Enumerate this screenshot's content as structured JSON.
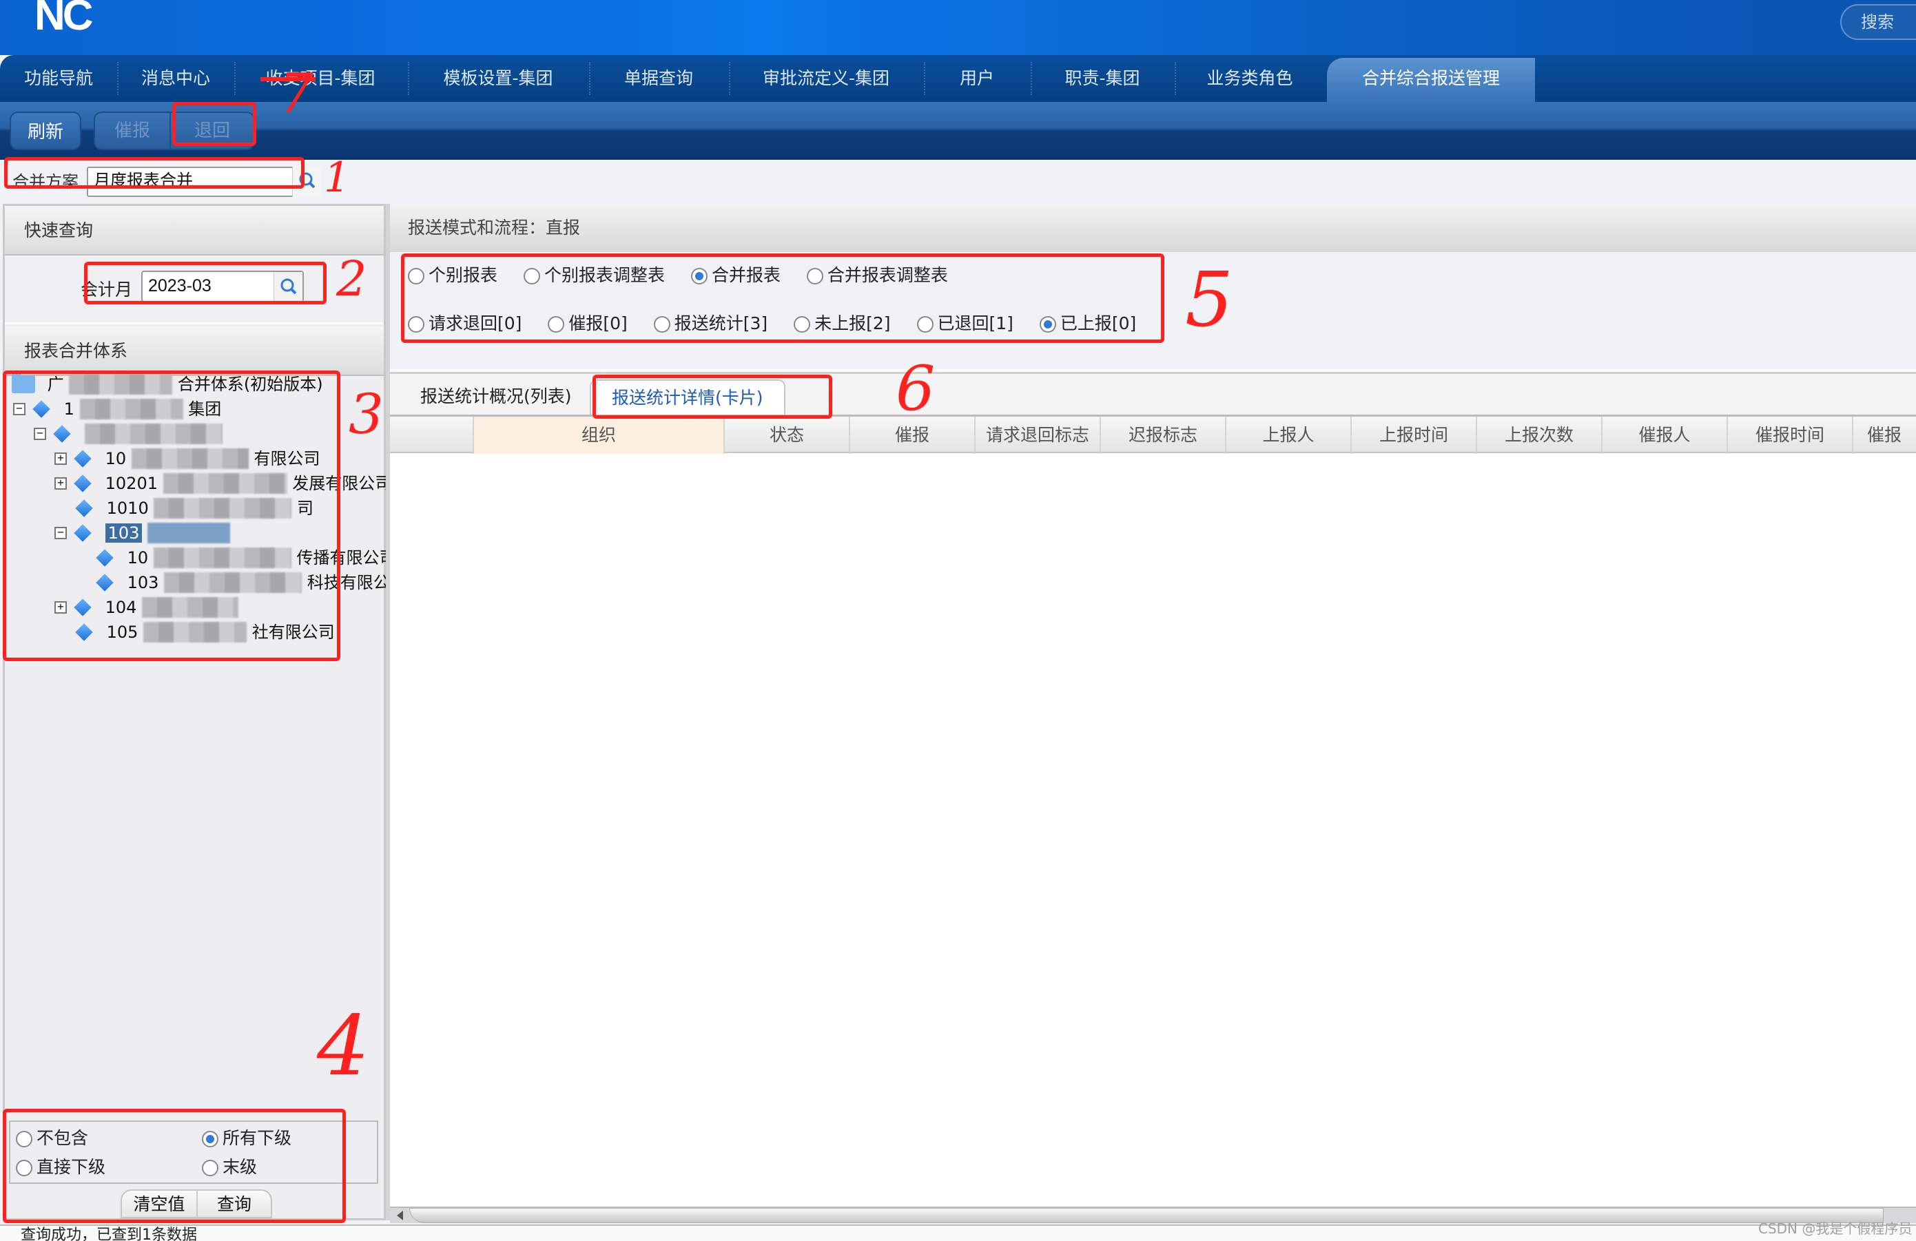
{
  "app": {
    "logo": "NC",
    "search_label": "搜索"
  },
  "nav": {
    "items": [
      {
        "label": "功能导航"
      },
      {
        "label": "消息中心"
      },
      {
        "label": "收支项目-集团"
      },
      {
        "label": "模板设置-集团"
      },
      {
        "label": "单据查询"
      },
      {
        "label": "审批流定义-集团"
      },
      {
        "label": "用户"
      },
      {
        "label": "职责-集团"
      },
      {
        "label": "业务类角色"
      },
      {
        "label": "合并综合报送管理",
        "active": true
      }
    ]
  },
  "toolbar": {
    "refresh": "刷新",
    "urge": "催报",
    "return": "退回"
  },
  "scheme": {
    "label": "合并方案",
    "value": "月度报表合并"
  },
  "left": {
    "quick_query_title": "快速查询",
    "month_label": "会计月",
    "month_value": "2023-03",
    "tree_title": "报表合并体系",
    "tree": [
      {
        "prefix": "广",
        "suffix": "合并体系(初始版本)",
        "level": 0,
        "type": "folder"
      },
      {
        "prefix": "1",
        "suffix": "集团",
        "level": 1,
        "toggle": "−"
      },
      {
        "prefix": "",
        "suffix": "",
        "level": 2,
        "toggle": "−"
      },
      {
        "prefix": "10",
        "suffix": "有限公司",
        "level": 3,
        "toggle": "+"
      },
      {
        "prefix": "10201",
        "suffix": "发展有限公司",
        "level": 3,
        "toggle": "+"
      },
      {
        "prefix": "1010",
        "suffix": "司",
        "level": 3,
        "toggle": ""
      },
      {
        "prefix": "103",
        "suffix": "",
        "level": 3,
        "toggle": "−",
        "selected": true
      },
      {
        "prefix": "10",
        "suffix": "传播有限公司",
        "level": 4,
        "toggle": ""
      },
      {
        "prefix": "103",
        "suffix": "科技有限公",
        "level": 4,
        "toggle": ""
      },
      {
        "prefix": "104",
        "suffix": "",
        "level": 3,
        "toggle": "+"
      },
      {
        "prefix": "105",
        "suffix": "社有限公司",
        "level": 3,
        "toggle": ""
      }
    ],
    "scope_options": [
      {
        "label": "不包含",
        "checked": false
      },
      {
        "label": "所有下级",
        "checked": true
      },
      {
        "label": "直接下级",
        "checked": false
      },
      {
        "label": "末级",
        "checked": false
      }
    ],
    "clear_button": "清空值",
    "query_button": "查询"
  },
  "right": {
    "mode_title": "报送模式和流程：直报",
    "report_types": [
      {
        "label": "个别报表",
        "checked": false
      },
      {
        "label": "个别报表调整表",
        "checked": false
      },
      {
        "label": "合并报表",
        "checked": true
      },
      {
        "label": "合并报表调整表",
        "checked": false
      }
    ],
    "status_filters": [
      {
        "label": "请求退回[0]",
        "checked": false
      },
      {
        "label": "催报[0]",
        "checked": false
      },
      {
        "label": "报送统计[3]",
        "checked": false
      },
      {
        "label": "未上报[2]",
        "checked": false
      },
      {
        "label": "已退回[1]",
        "checked": false
      },
      {
        "label": "已上报[0]",
        "checked": true
      }
    ],
    "tabs": [
      {
        "label": "报送统计概况(列表)",
        "active": false
      },
      {
        "label": "报送统计详情(卡片)",
        "active": true
      }
    ],
    "columns": [
      "组织",
      "状态",
      "催报",
      "请求退回标志",
      "迟报标志",
      "上报人",
      "上报时间",
      "上报次数",
      "催报人",
      "催报时间",
      "催报"
    ]
  },
  "status_bar": {
    "message": "查询成功，已查到1条数据"
  },
  "watermark": "CSDN @我是个假程序员",
  "annotations": [
    "1",
    "2",
    "3",
    "4",
    "5",
    "6",
    "7"
  ],
  "colors": {
    "brand_blue": "#0a63d1",
    "nav_dark": "#063f82",
    "annotation_red": "#ff2020",
    "selected_blue": "#3c6da4"
  }
}
